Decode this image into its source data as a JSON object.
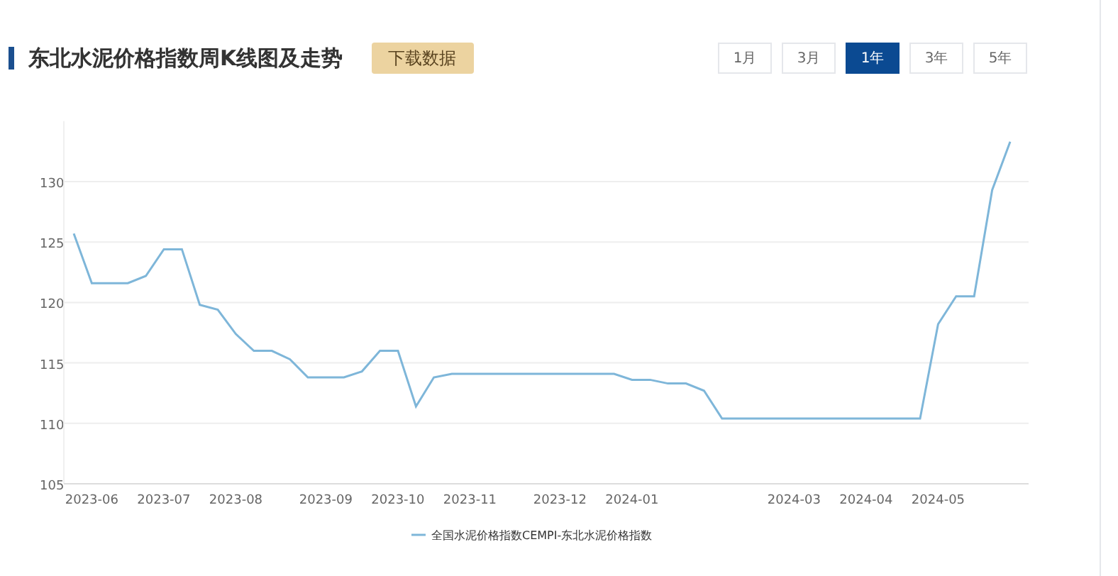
{
  "header": {
    "title": "东北水泥价格指数周K线图及走势",
    "download_button": "下载数据"
  },
  "range_tabs": [
    {
      "label": "1月",
      "selected": false
    },
    {
      "label": "3月",
      "selected": false
    },
    {
      "label": "1年",
      "selected": true
    },
    {
      "label": "3年",
      "selected": false
    },
    {
      "label": "5年",
      "selected": false
    }
  ],
  "chart": {
    "chart_data": {
      "type": "line",
      "grid": true,
      "ylim": [
        105,
        135
      ],
      "yticks": [
        105,
        110,
        115,
        120,
        125,
        130
      ],
      "categories": [
        null,
        "2023-06",
        null,
        null,
        null,
        "2023-07",
        null,
        null,
        null,
        "2023-08",
        null,
        null,
        null,
        null,
        "2023-09",
        null,
        null,
        null,
        "2023-10",
        null,
        null,
        null,
        "2023-11",
        null,
        null,
        null,
        null,
        "2023-12",
        null,
        null,
        null,
        "2024-01",
        null,
        null,
        null,
        null,
        null,
        null,
        null,
        null,
        "2024-03",
        null,
        null,
        null,
        "2024-04",
        null,
        null,
        null,
        "2024-05",
        null,
        null,
        null,
        null
      ],
      "series": [
        {
          "name": "全国水泥价格指数CEMPI-东北水泥价格指数",
          "color": "#7eb6d9",
          "values": [
            125.7,
            121.6,
            121.6,
            121.6,
            122.2,
            124.4,
            124.4,
            119.8,
            119.4,
            117.4,
            116,
            116,
            115.3,
            113.8,
            113.8,
            113.8,
            114.3,
            116,
            116,
            111.4,
            113.8,
            114.1,
            114.1,
            114.1,
            114.1,
            114.1,
            114.1,
            114.1,
            114.1,
            114.1,
            114.1,
            113.6,
            113.6,
            113.3,
            113.3,
            112.7,
            110.4,
            110.4,
            110.4,
            110.4,
            110.4,
            110.4,
            110.4,
            110.4,
            110.4,
            110.4,
            110.4,
            110.4,
            118.2,
            120.5,
            120.5,
            129.3,
            133.3
          ]
        }
      ]
    }
  }
}
